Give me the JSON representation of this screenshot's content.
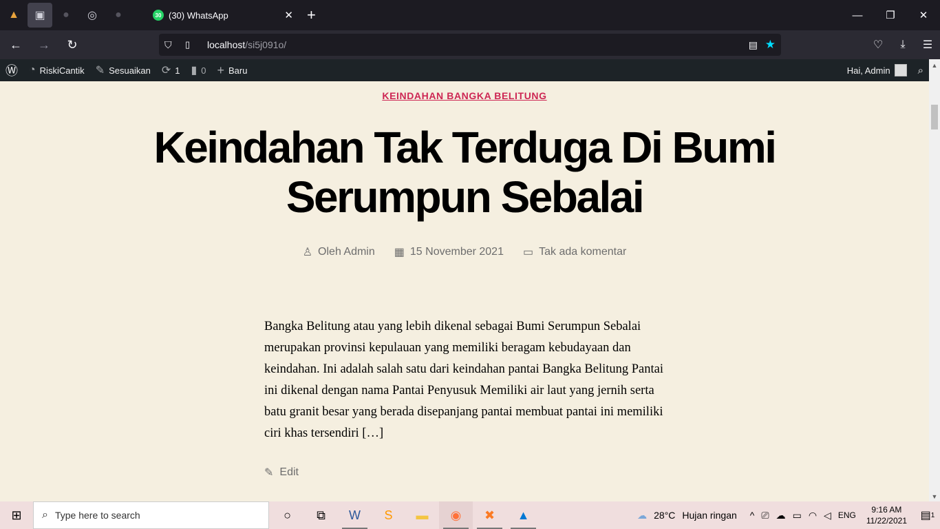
{
  "browser": {
    "tab_title": "(30) WhatsApp",
    "tab_badge": "30",
    "url_host": "localhost",
    "url_path": "/si5j091o/"
  },
  "adminbar": {
    "site_name": "RiskiCantik",
    "customize": "Sesuaikan",
    "updates_count": "1",
    "comments_count": "0",
    "new_label": "Baru",
    "greeting": "Hai, Admin"
  },
  "post": {
    "category": "KEINDAHAN BANGKA BELITUNG",
    "title": "Keindahan Tak Terduga Di Bumi Serumpun Sebalai",
    "author": "Oleh Admin",
    "date": "15 November 2021",
    "comments": "Tak ada komentar",
    "excerpt": "Bangka Belitung atau yang lebih dikenal sebagai Bumi Serumpun Sebalai merupakan provinsi kepulauan yang memiliki beragam kebudayaan dan keindahan. Ini adalah salah satu dari keindahan pantai Bangka Belitung Pantai ini dikenal dengan nama Pantai Penyusuk Memiliki air laut yang jernih serta batu granit besar yang berada disepanjang pantai membuat pantai ini memiliki ciri khas tersendiri […]",
    "edit_label": "Edit",
    "category_color": "#cd2653"
  },
  "taskbar": {
    "search_placeholder": "Type here to search",
    "weather_temp": "28°C",
    "weather_desc": "Hujan ringan",
    "language": "ENG",
    "time": "9:16 AM",
    "date": "11/22/2021",
    "notification_count": "1"
  }
}
